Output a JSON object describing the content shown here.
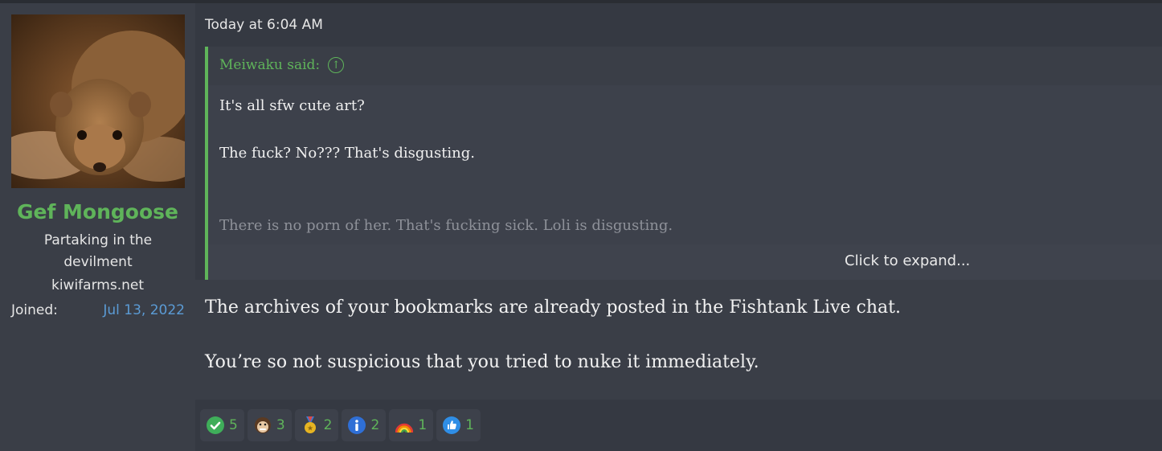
{
  "user": {
    "name": "Gef Mongoose",
    "title": "Partaking in the devilment",
    "site": "kiwifarms.net",
    "joined_label": "Joined:",
    "joined_date": "Jul 13, 2022"
  },
  "post": {
    "date": "Today at 6:04 AM",
    "quote": {
      "author": "Meiwaku said:",
      "lines": [
        "It's all sfw cute art?",
        "The fuck? No??? That's disgusting.",
        "There is no porn of her. That's fucking sick. Loli is disgusting."
      ],
      "expand_label": "Click to expand..."
    },
    "body": [
      "The archives of your bookmarks are already posted in the Fishtank Live chat.",
      "You’re so not suspicious that you tried to nuke it immediately."
    ]
  },
  "reactions": [
    {
      "icon": "check-icon",
      "count": "5"
    },
    {
      "icon": "monkey-face-icon",
      "count": "3"
    },
    {
      "icon": "medal-icon",
      "count": "2"
    },
    {
      "icon": "info-icon",
      "count": "2"
    },
    {
      "icon": "rainbow-icon",
      "count": "1"
    },
    {
      "icon": "thumbs-up-icon",
      "count": "1"
    }
  ],
  "colors": {
    "accent_green": "#5fb45a",
    "link_blue": "#5b9bd5"
  }
}
